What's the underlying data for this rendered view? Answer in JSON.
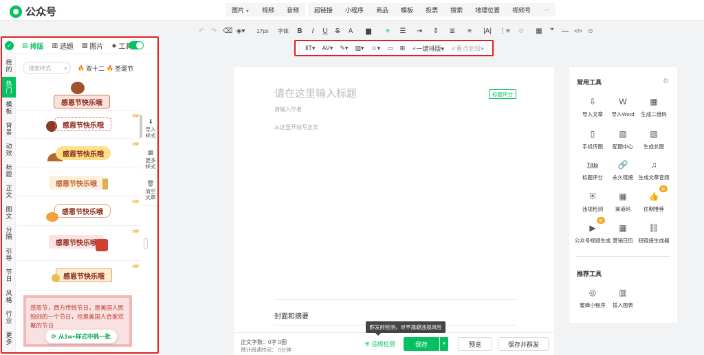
{
  "app": {
    "name": "公众号"
  },
  "insert_bar_a": [
    "图片",
    "视频",
    "音频"
  ],
  "insert_bar_b": [
    "超链接",
    "小程序",
    "商品",
    "模板",
    "投票",
    "搜索",
    "地理位置",
    "视频号",
    "···"
  ],
  "format_bar": {
    "font_size": "17px",
    "font_family": "字体",
    "buttons": [
      "B",
      "I",
      "U",
      "S",
      "A"
    ]
  },
  "format_bar2": {
    "one_click_layout": "一键排版",
    "highlight_line": "重点划线"
  },
  "left_panel": {
    "tabs": [
      {
        "label": "排版",
        "icon": "layout-icon"
      },
      {
        "label": "选题",
        "icon": "book-icon"
      },
      {
        "label": "图片",
        "icon": "image-icon"
      },
      {
        "label": "工具",
        "icon": "cube-icon"
      }
    ],
    "side_nav": [
      [
        "我",
        "的"
      ],
      [
        "热",
        "门"
      ],
      [
        "模",
        "板"
      ],
      [
        "背",
        "景"
      ],
      [
        "动",
        "效"
      ],
      [
        "标",
        "题"
      ],
      [
        "正",
        "文"
      ],
      [
        "图",
        "文"
      ],
      [
        "分",
        "隔"
      ],
      [
        "引",
        "导"
      ],
      [
        "节",
        "日"
      ],
      [
        "风",
        "格"
      ],
      [
        "行",
        "业"
      ],
      [
        "更",
        "多"
      ]
    ],
    "search_placeholder": "搜索样式",
    "hot_tags": [
      "双十二",
      "圣诞节"
    ],
    "template_label": "感恩节快乐哦",
    "vip": "VIP",
    "last_template_text": "感恩节，西方传统节日，是美国人民独创的一个节日，也是美国人合家欢聚的节日",
    "more_button": "从1w+样式中挑一批",
    "right_actions": [
      [
        "导入",
        "样式"
      ],
      [
        "更多",
        "样式"
      ],
      [
        "清空",
        "文章"
      ]
    ]
  },
  "editor": {
    "title_placeholder": "请在这里输入标题",
    "title_score": "标题评分",
    "author_placeholder": "请输入作者",
    "body_placeholder": "从这里开始写正文",
    "cover_label": "封面和摘要"
  },
  "tools": {
    "common_title": "常用工具",
    "common": [
      {
        "label": "导入文章",
        "icon": "import-icon"
      },
      {
        "label": "导入Word",
        "icon": "word-icon"
      },
      {
        "label": "生成二维码",
        "icon": "qrcode-icon"
      },
      {
        "label": "手机传图",
        "icon": "phone-icon"
      },
      {
        "label": "配图中心",
        "icon": "picture-icon"
      },
      {
        "label": "生成长图",
        "icon": "long-image-icon"
      },
      {
        "label": "标题评分",
        "icon": "title-score-icon",
        "glyph": "Title"
      },
      {
        "label": "永久链接",
        "icon": "link-icon"
      },
      {
        "label": "生成文章音频",
        "icon": "music-icon"
      },
      {
        "label": "违规检测",
        "icon": "shield-icon"
      },
      {
        "label": "渠道码",
        "icon": "channel-code-icon"
      },
      {
        "label": "往期推荐",
        "icon": "thumb-up-icon"
      },
      {
        "label": "公众号视频生成",
        "icon": "video-gen-icon"
      },
      {
        "label": "营销日历",
        "icon": "calendar-icon"
      },
      {
        "label": "短链接生成器",
        "icon": "short-link-icon"
      }
    ],
    "new_badge": "新",
    "recommend_title": "推荐工具",
    "recommend": [
      {
        "label": "蜜蜂小程序",
        "icon": "mini-program-icon"
      },
      {
        "label": "插入图表",
        "icon": "chart-icon"
      }
    ]
  },
  "bottom": {
    "word_count": "正文字数：0字 0图",
    "reading_time": "预计阅读时间： 0分钟",
    "violation_check": "违规检测",
    "tooltip": "群发前检测，尽早规避违规风险",
    "save": "保存",
    "preview": "预览",
    "save_publish": "保存并群发"
  }
}
